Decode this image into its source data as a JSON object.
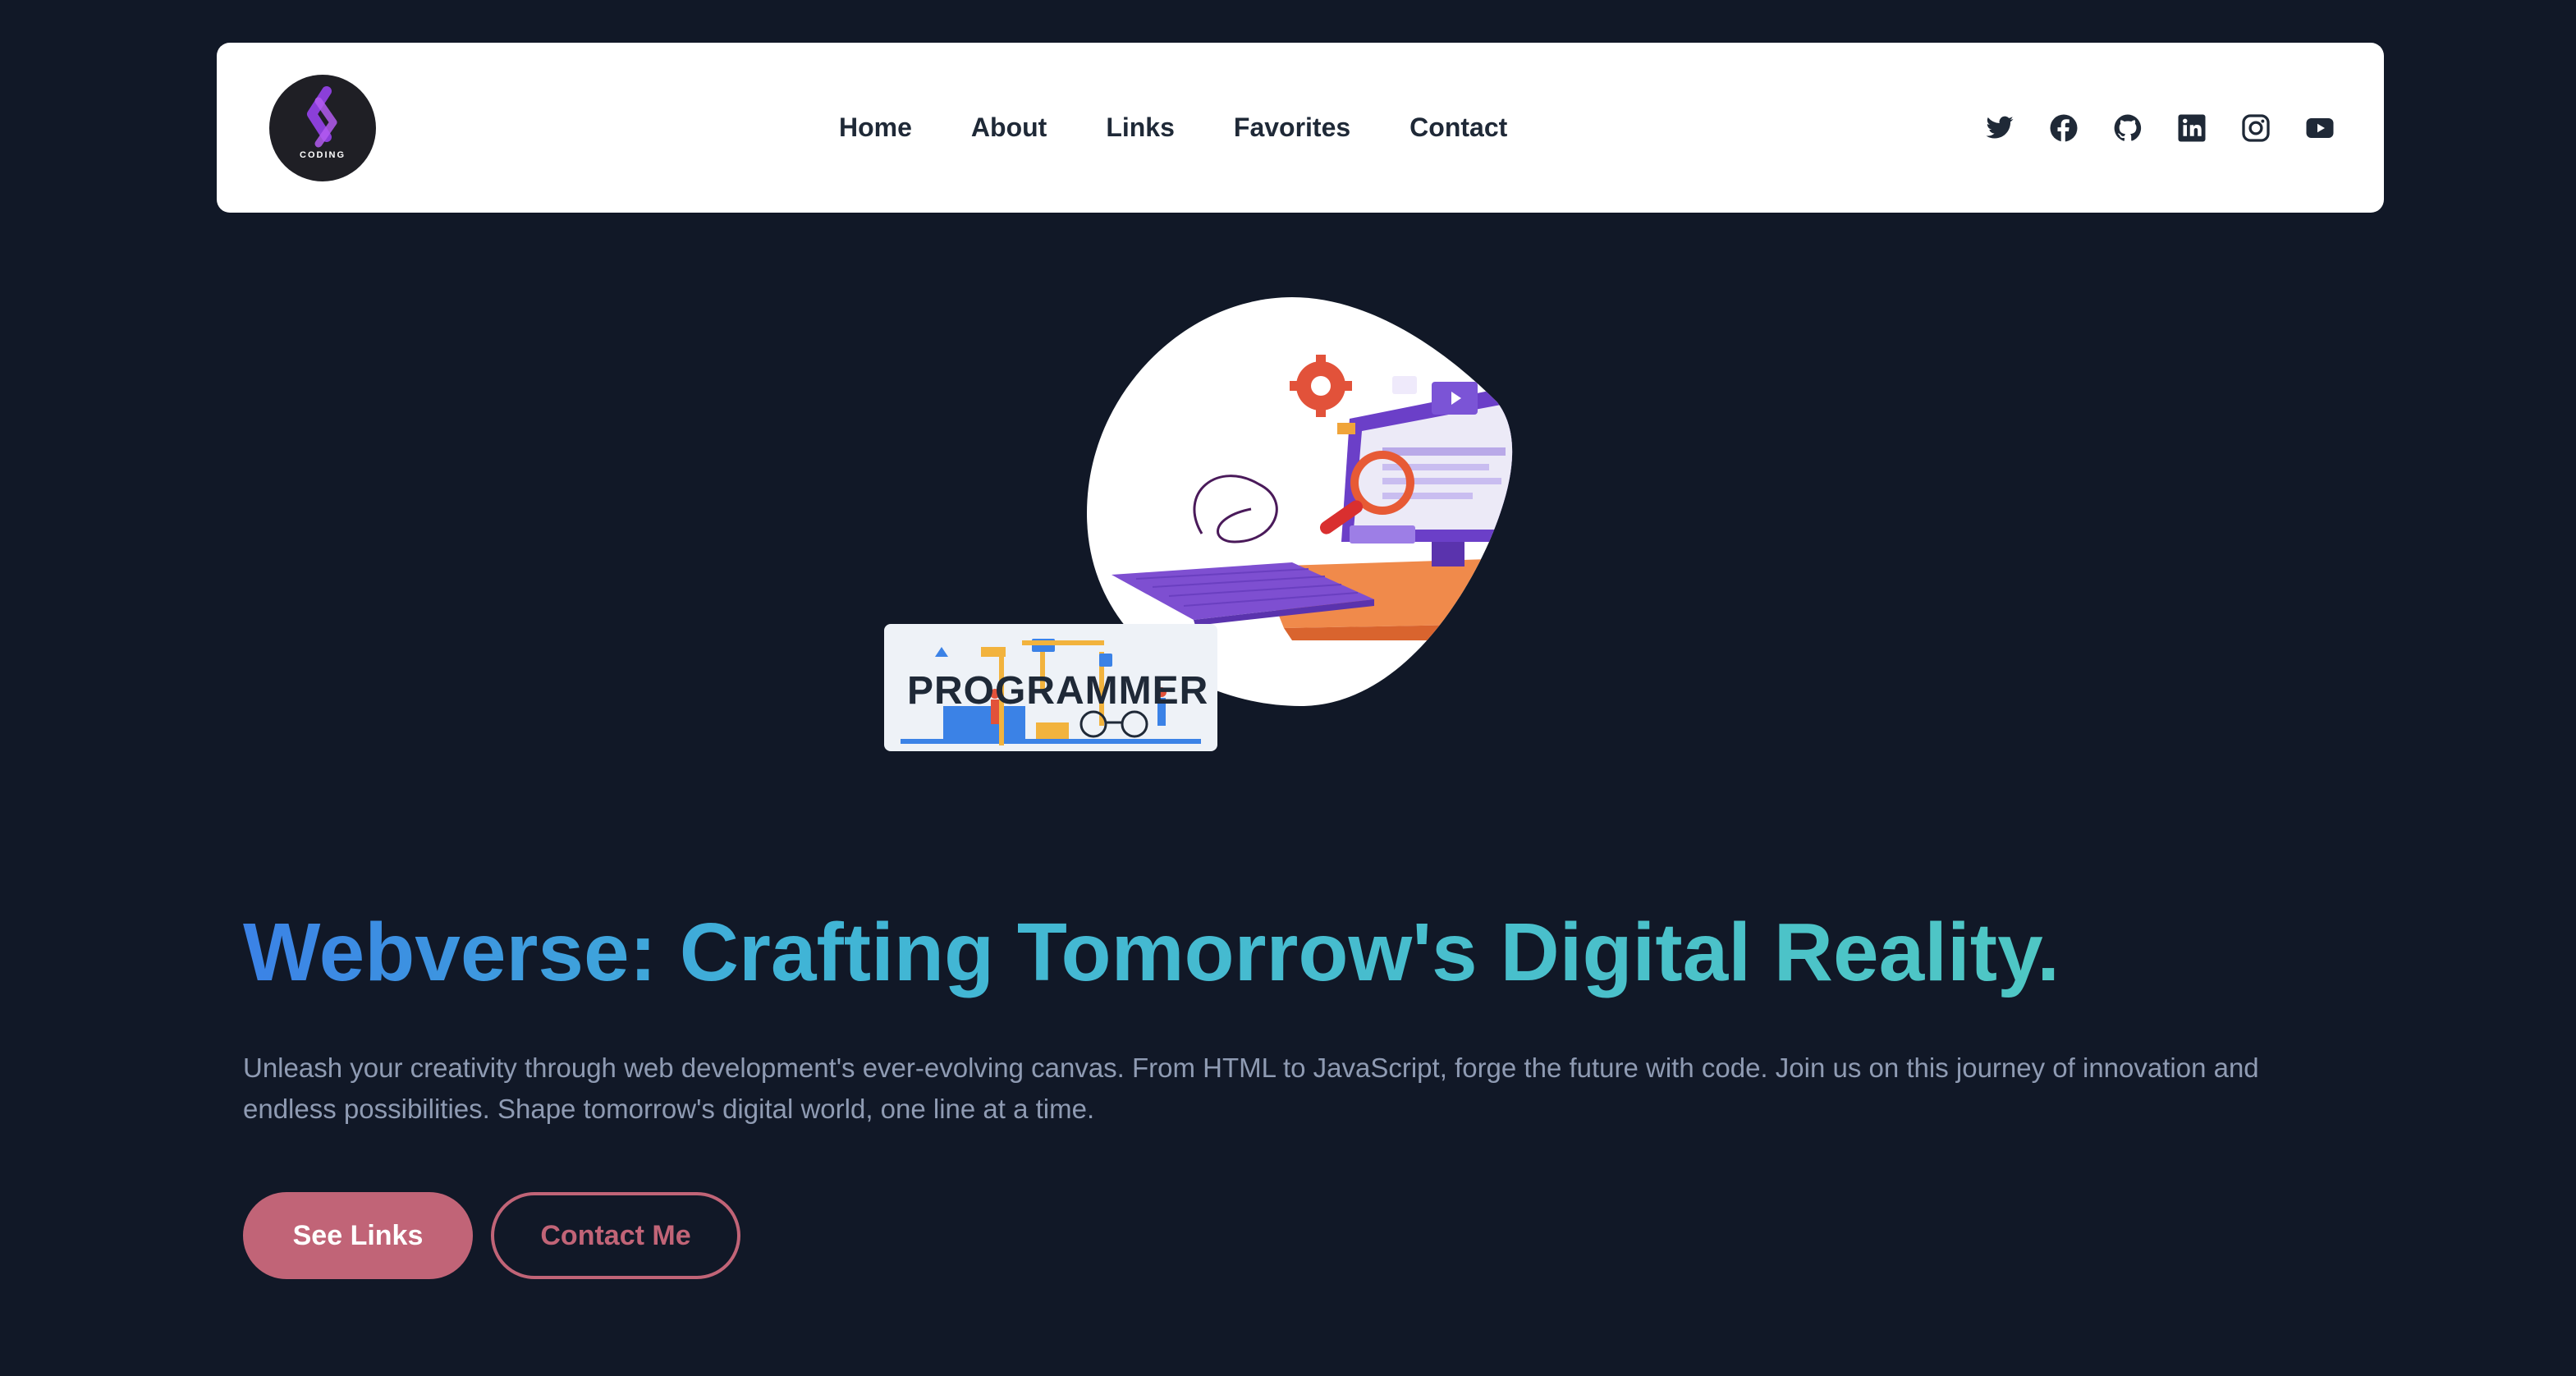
{
  "navbar": {
    "logo_text": "CODING",
    "logo_icon": "coding-logo-icon",
    "links": [
      {
        "label": "Home"
      },
      {
        "label": "About"
      },
      {
        "label": "Links"
      },
      {
        "label": "Favorites"
      },
      {
        "label": "Contact"
      }
    ],
    "socials": [
      "twitter-icon",
      "facebook-icon",
      "github-icon",
      "linkedin-icon",
      "instagram-icon",
      "youtube-icon"
    ]
  },
  "hero": {
    "illustration": "computer-illustration",
    "card_text": "PROGRAMMER",
    "headline": "Webverse: Crafting Tomorrow's Digital Reality.",
    "subtext": "Unleash your creativity through web development's ever-evolving canvas. From HTML to JavaScript, forge the future with code. Join us on this journey of innovation and endless possibilities. Shape tomorrow's digital world, one line at a time.",
    "primary_button": "See Links",
    "secondary_button": "Contact Me"
  },
  "colors": {
    "background": "#111827",
    "navbar": "#ffffff",
    "accent": "#c16477",
    "gradient_start": "#3b82e6",
    "gradient_end": "#4fc7c4",
    "subtext": "#8f9bb3"
  }
}
